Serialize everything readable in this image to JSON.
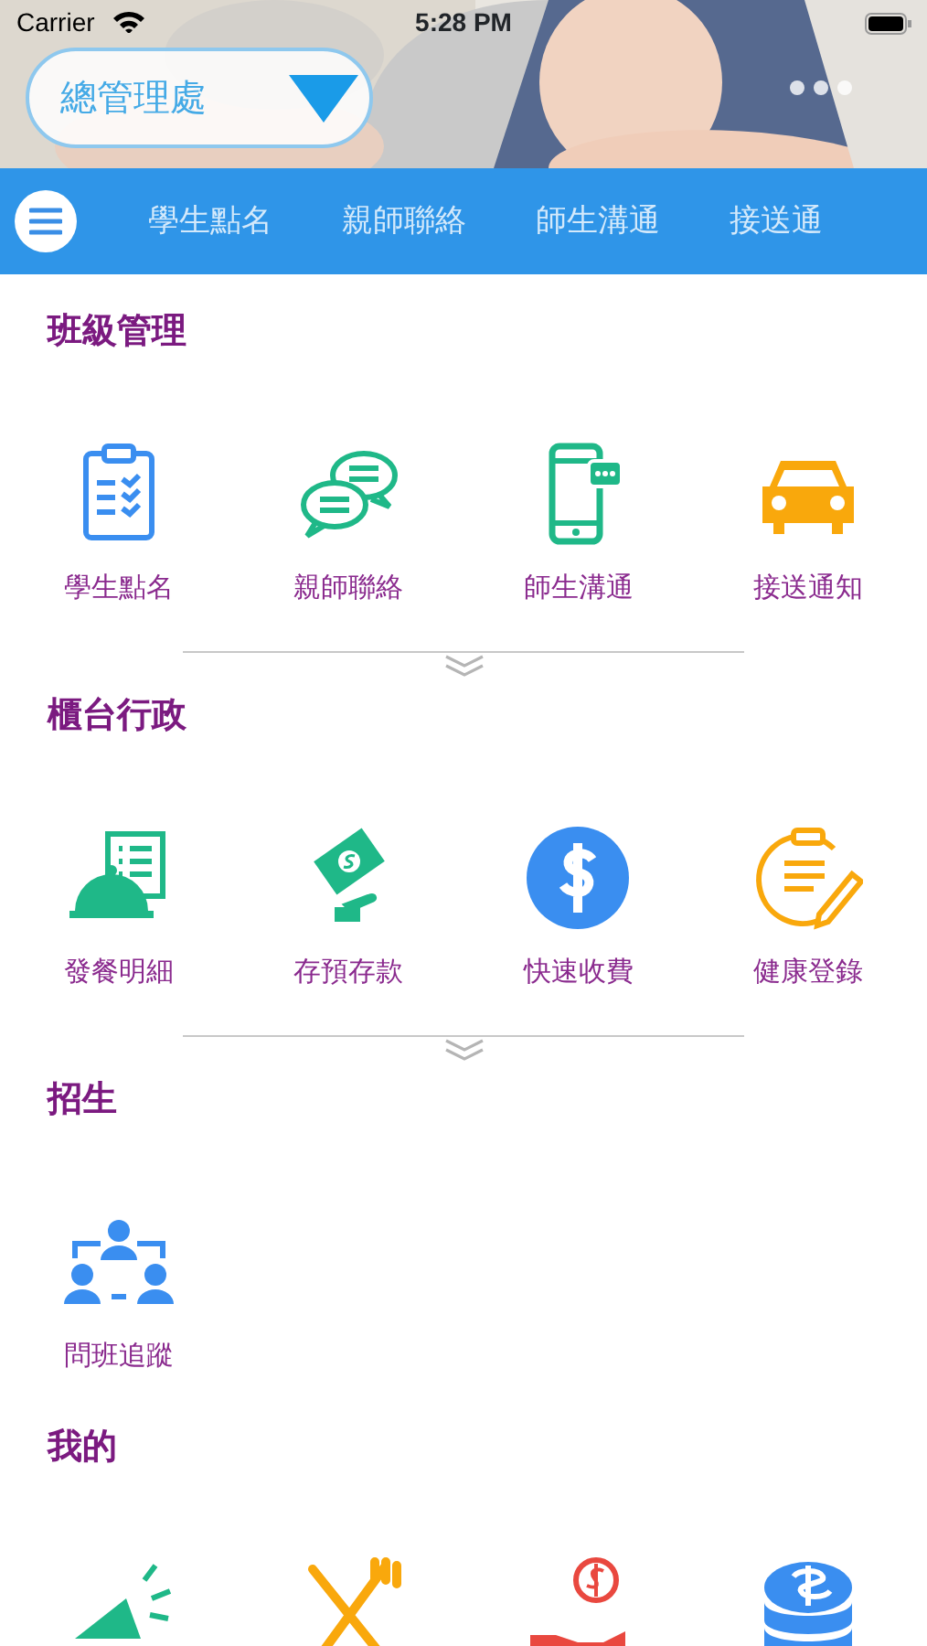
{
  "status_bar": {
    "carrier": "Carrier",
    "time": "5:28 PM"
  },
  "banner": {
    "kind": "picture",
    "selector": {
      "value": "總管理處"
    }
  },
  "tabs": [
    {
      "label": "學生點名"
    },
    {
      "label": "親師聯絡"
    },
    {
      "label": "師生溝通"
    },
    {
      "label": "接送通"
    }
  ],
  "sections": [
    {
      "title": "班級管理",
      "collapsible": true,
      "items": [
        {
          "kind": "clipboard",
          "label": "學生點名"
        },
        {
          "kind": "chat",
          "label": "親師聯絡"
        },
        {
          "kind": "phone",
          "label": "師生溝通"
        },
        {
          "kind": "car",
          "label": "接送通知"
        }
      ]
    },
    {
      "title": "櫃台行政",
      "collapsible": true,
      "items": [
        {
          "kind": "cloche",
          "label": "發餐明細"
        },
        {
          "kind": "cash",
          "label": "存預存款"
        },
        {
          "kind": "dollar",
          "label": "快速收費"
        },
        {
          "kind": "notepen",
          "label": "健康登錄"
        }
      ]
    },
    {
      "title": "招生",
      "collapsible": false,
      "items": [
        {
          "kind": "people",
          "label": "問班追蹤"
        }
      ]
    },
    {
      "title": "我的",
      "collapsible": false,
      "items": [
        {
          "kind": "megaphone"
        },
        {
          "kind": "utensils"
        },
        {
          "kind": "moneyhand"
        },
        {
          "kind": "coins"
        }
      ]
    }
  ]
}
